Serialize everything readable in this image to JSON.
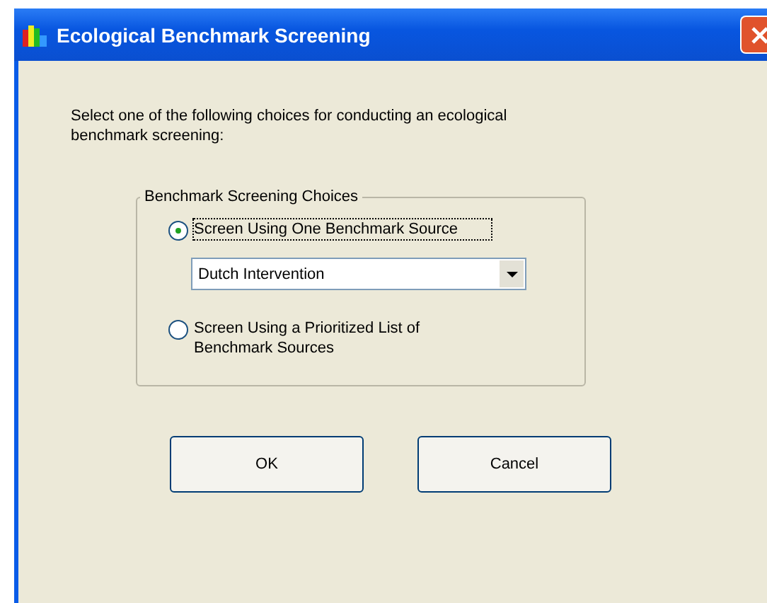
{
  "window": {
    "title": "Ecological Benchmark Screening"
  },
  "instruction": "Select one of the following choices for conducting an ecological benchmark screening:",
  "group": {
    "title": "Benchmark Screening Choices",
    "options": [
      {
        "label": "Screen Using One Benchmark Source",
        "selected": true
      },
      {
        "label": "Screen Using a Prioritized List of Benchmark Sources",
        "selected": false
      }
    ],
    "dropdown": {
      "value": "Dutch Intervention"
    }
  },
  "buttons": [
    "OK",
    "Cancel"
  ]
}
